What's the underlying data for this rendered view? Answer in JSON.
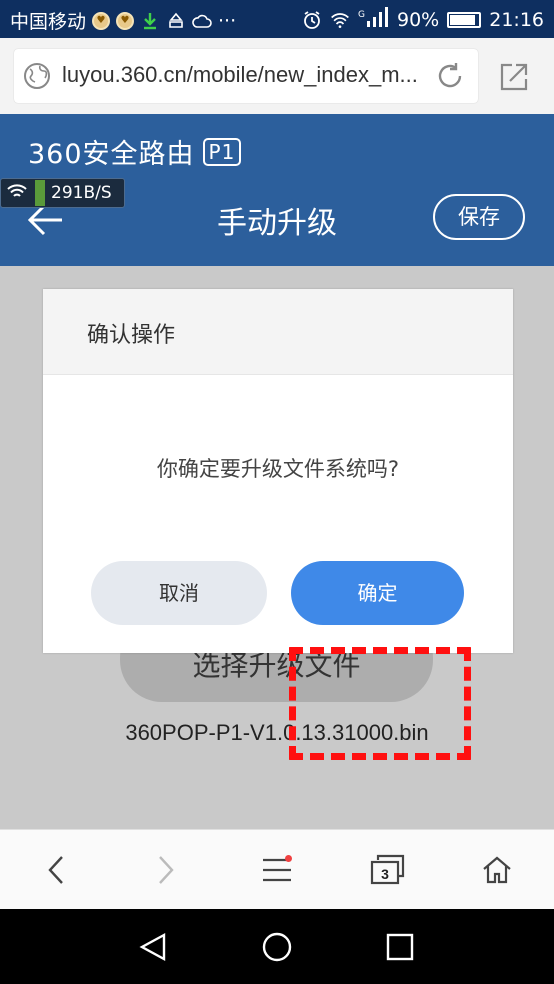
{
  "status_bar": {
    "carrier": "中国移动",
    "network": "G",
    "battery": "90%",
    "battery_level": 0.9,
    "time": "21:16",
    "more": "···"
  },
  "browser": {
    "url": "luyou.360.cn/mobile/new_index_m...",
    "tabs_count": "3"
  },
  "page": {
    "brand": "360安全路由",
    "model": "P1",
    "title": "手动升级",
    "save_label": "保存",
    "speed_text": "291B/S",
    "select_file_label": "选择升级文件",
    "filename": "360POP-P1-V1.0.13.31000.bin"
  },
  "dialog": {
    "title": "确认操作",
    "message": "你确定要升级文件系统吗?",
    "cancel_label": "取消",
    "confirm_label": "确定"
  },
  "colors": {
    "status_bar": "#0e2f60",
    "header": "#2c5f9c",
    "confirm_button": "#3f89e8",
    "highlight": "#ff1010"
  }
}
